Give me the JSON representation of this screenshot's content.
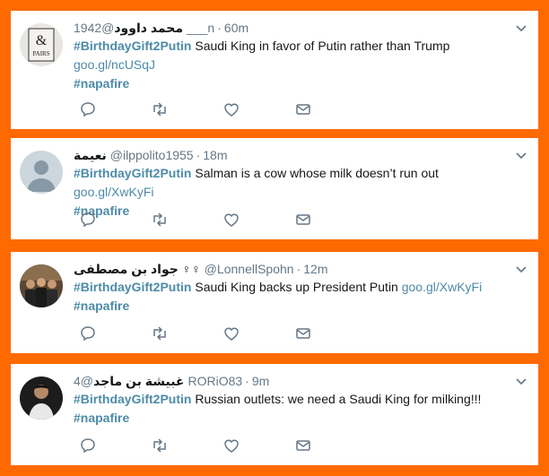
{
  "tweets": [
    {
      "name": "محمد داوود",
      "handle": "@1942___n",
      "time": "60m",
      "hashtag": "#BirthdayGift2Putin",
      "text": "Saudi King in favor of Putin rather than Trump",
      "link": "goo.gl/ncUSqJ",
      "hashtag2": "#napafire",
      "avatar_icon": "pairs-logo-avatar"
    },
    {
      "name": "نعيمة",
      "handle": "@ilppolito1955",
      "time": "18m",
      "hashtag": "#BirthdayGift2Putin",
      "text": "Salman is a cow whose milk doesn’t run out",
      "link": "goo.gl/XwKyFi",
      "hashtag2": "#napafire",
      "avatar_icon": "default-user-avatar"
    },
    {
      "name": "جواد بن مصطفى ♀♀",
      "handle": "@LonnellSpohn",
      "time": "12m",
      "hashtag": "#BirthdayGift2Putin",
      "text": "Saudi King backs up President Putin",
      "link": "goo.gl/XwKyFi",
      "hashtag2": "#napafire",
      "avatar_icon": "group-photo-avatar"
    },
    {
      "name": "غبيشة بن ماجد",
      "handle": "@4RORiO83",
      "time": "9m",
      "hashtag": "#BirthdayGift2Putin",
      "text": "Russian outlets: we need a Saudi King for milking!!!",
      "link": "",
      "hashtag2": "#napafire",
      "avatar_icon": "person-photo-avatar"
    }
  ],
  "colors": {
    "background": "#ff6a00",
    "hashtag": "#4d8ba8",
    "meta": "#657786"
  }
}
